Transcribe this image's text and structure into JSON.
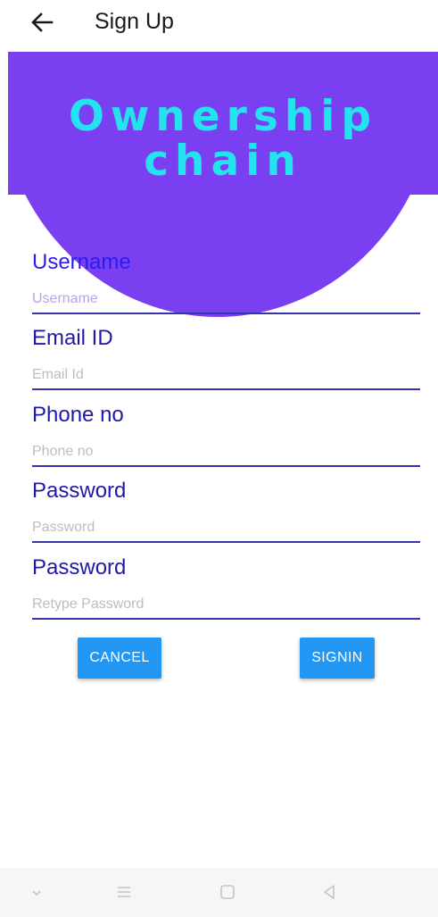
{
  "appbar": {
    "title": "Sign Up",
    "back_icon": "arrow-left-icon"
  },
  "banner": {
    "title_line1": "Ownership",
    "title_line2": "chain",
    "background_color": "#7b3ff2",
    "title_color": "#22e3ee"
  },
  "form": {
    "username": {
      "label": "Username",
      "placeholder": "Username",
      "value": ""
    },
    "email": {
      "label": "Email ID",
      "placeholder": "Email Id",
      "value": ""
    },
    "phone": {
      "label": "Phone no",
      "placeholder": "Phone no",
      "value": ""
    },
    "password": {
      "label": "Password",
      "placeholder": "Password",
      "value": ""
    },
    "retype_password": {
      "label": "Password",
      "placeholder": "Retype Password",
      "value": ""
    }
  },
  "buttons": {
    "cancel_label": "CANCEL",
    "signin_label": "SIGNIN",
    "button_color": "#2196f3"
  },
  "navbar": {
    "icons": [
      "chevron-down-icon",
      "menu-icon",
      "home-square-icon",
      "back-triangle-icon"
    ]
  }
}
